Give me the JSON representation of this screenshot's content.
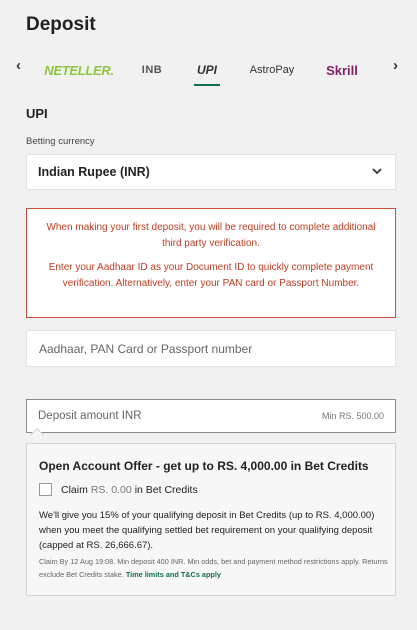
{
  "page": {
    "title": "Deposit"
  },
  "methods": {
    "prev_icon": "chevron-left-icon",
    "next_icon": "chevron-right-icon",
    "items": [
      {
        "label": "NETELLER."
      },
      {
        "label": "INB"
      },
      {
        "label": "UPI"
      },
      {
        "label": "AstroPay"
      },
      {
        "label": "Skrill"
      }
    ],
    "active": "UPI",
    "active_color": "#126e51"
  },
  "section": {
    "label": "UPI",
    "currency_label": "Betting currency",
    "currency_value": "Indian Rupee (INR)"
  },
  "notice": {
    "line1": "When making your first deposit, you will be required to complete additional third party verification.",
    "line2": "Enter your Aadhaar ID as your Document ID to quickly complete payment verification. Alternatively, enter your PAN card or Passport Number.",
    "color": "#c23b21"
  },
  "document_input": {
    "placeholder": "Aadhaar, PAN Card or Passport number",
    "value": ""
  },
  "amount": {
    "placeholder": "Deposit amount INR",
    "min": "Min RS. 500.00"
  },
  "offer": {
    "title": "Open Account Offer - get up to RS. 4,000.00 in Bet Credits",
    "claim_label": "Claim",
    "claim_amount": "RS. 0.00",
    "claim_suffix": "in Bet Credits",
    "checked": false,
    "body": "We'll give you 15% of your qualifying deposit in Bet Credits (up to RS. 4,000.00) when you meet the qualifying settled bet requirement on your qualifying deposit (capped at RS. 26,666.67).",
    "fine_print": "Claim By 12 Aug 19:08. Min deposit 400 INR. Min odds, bet and payment method restrictions apply. Returns exclude Bet Credits stake.",
    "tc_link": "Time limits and T&Cs apply",
    "link_color": "#126e51"
  }
}
